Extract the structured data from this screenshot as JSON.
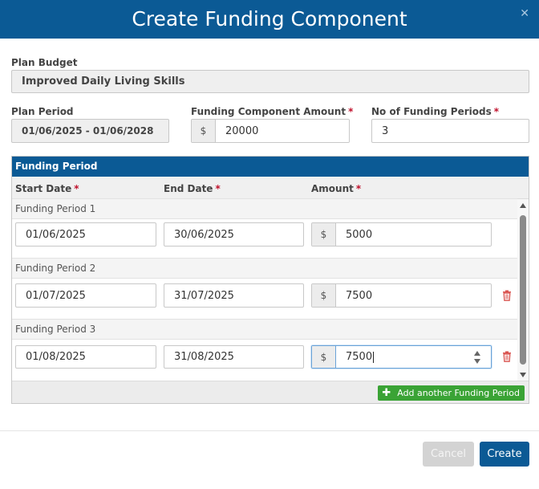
{
  "dialog": {
    "title": "Create Funding Component",
    "close_icon": "close-icon"
  },
  "plan_budget": {
    "label": "Plan Budget",
    "value": "Improved Daily Living Skills"
  },
  "plan_period": {
    "label": "Plan Period",
    "value": "01/06/2025 - 01/06/2028"
  },
  "funding_amount": {
    "label": "Funding Component Amount",
    "required": "*",
    "currency": "$",
    "value": "20000"
  },
  "num_periods": {
    "label": "No of Funding Periods",
    "required": "*",
    "value": "3"
  },
  "funding_period_panel": {
    "title": "Funding Period",
    "columns": {
      "start": "Start Date",
      "end": "End Date",
      "amount": "Amount",
      "required": "*"
    },
    "periods": [
      {
        "title": "Funding Period 1",
        "start": "01/06/2025",
        "end": "30/06/2025",
        "currency": "$",
        "amount": "5000",
        "deletable": false
      },
      {
        "title": "Funding Period 2",
        "start": "01/07/2025",
        "end": "31/07/2025",
        "currency": "$",
        "amount": "7500",
        "deletable": true
      },
      {
        "title": "Funding Period 3",
        "start": "01/08/2025",
        "end": "31/08/2025",
        "currency": "$",
        "amount": "7500",
        "deletable": true
      }
    ],
    "add_button": "Add another Funding Period"
  },
  "footer": {
    "cancel": "Cancel",
    "create": "Create"
  },
  "colors": {
    "header": "#0b5a95",
    "required": "#c0102b",
    "add_button": "#3aa335",
    "trash_icon": "#d9534f"
  }
}
